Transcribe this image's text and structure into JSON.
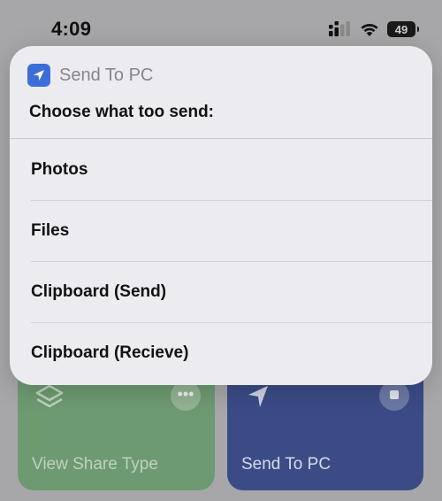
{
  "status_bar": {
    "time": "4:09",
    "battery": "49"
  },
  "background_cards": [
    {
      "label": "View Share Type",
      "color": "#6e9a71"
    },
    {
      "label": "Send To PC",
      "color": "#3b4b86"
    }
  ],
  "popup": {
    "app_name": "Send To PC",
    "prompt": "Choose what too send:",
    "options": [
      {
        "label": "Photos"
      },
      {
        "label": "Files"
      },
      {
        "label": "Clipboard (Send)"
      },
      {
        "label": "Clipboard (Recieve)"
      }
    ],
    "accent_color": "#3d6ed8"
  }
}
